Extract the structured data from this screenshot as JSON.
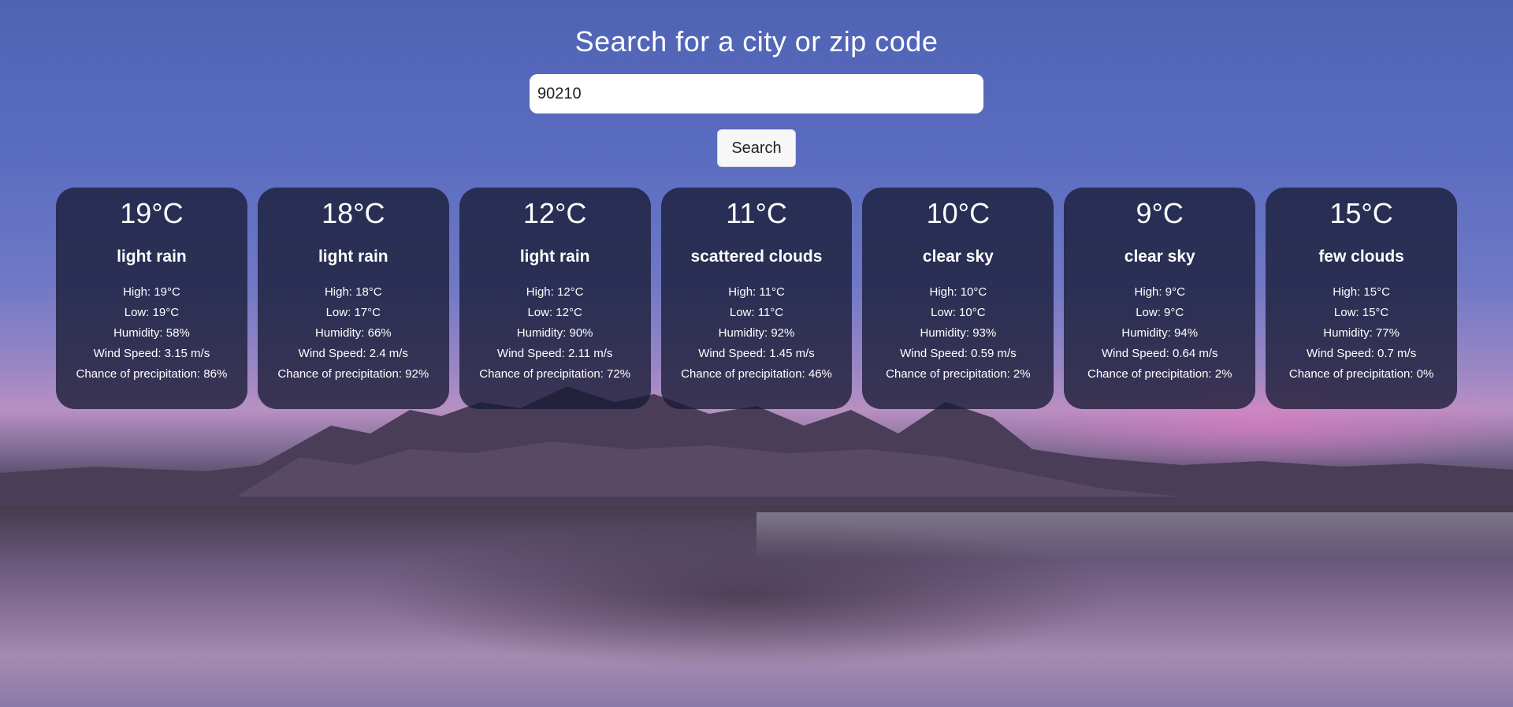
{
  "header": {
    "title": "Search for a city or zip code"
  },
  "search": {
    "value": "90210",
    "button_label": "Search"
  },
  "forecast": [
    {
      "temp": "19°C",
      "description": "light rain",
      "high": "High: 19°C",
      "low": "Low: 19°C",
      "humidity": "Humidity: 58%",
      "wind": "Wind Speed: 3.15 m/s",
      "precip": "Chance of precipitation: 86%"
    },
    {
      "temp": "18°C",
      "description": "light rain",
      "high": "High: 18°C",
      "low": "Low: 17°C",
      "humidity": "Humidity: 66%",
      "wind": "Wind Speed: 2.4 m/s",
      "precip": "Chance of precipitation: 92%"
    },
    {
      "temp": "12°C",
      "description": "light rain",
      "high": "High: 12°C",
      "low": "Low: 12°C",
      "humidity": "Humidity: 90%",
      "wind": "Wind Speed: 2.11 m/s",
      "precip": "Chance of precipitation: 72%"
    },
    {
      "temp": "11°C",
      "description": "scattered clouds",
      "high": "High: 11°C",
      "low": "Low: 11°C",
      "humidity": "Humidity: 92%",
      "wind": "Wind Speed: 1.45 m/s",
      "precip": "Chance of precipitation: 46%"
    },
    {
      "temp": "10°C",
      "description": "clear sky",
      "high": "High: 10°C",
      "low": "Low: 10°C",
      "humidity": "Humidity: 93%",
      "wind": "Wind Speed: 0.59 m/s",
      "precip": "Chance of precipitation: 2%"
    },
    {
      "temp": "9°C",
      "description": "clear sky",
      "high": "High: 9°C",
      "low": "Low: 9°C",
      "humidity": "Humidity: 94%",
      "wind": "Wind Speed: 0.64 m/s",
      "precip": "Chance of precipitation: 2%"
    },
    {
      "temp": "15°C",
      "description": "few clouds",
      "high": "High: 15°C",
      "low": "Low: 15°C",
      "humidity": "Humidity: 77%",
      "wind": "Wind Speed: 0.7 m/s",
      "precip": "Chance of precipitation: 0%"
    }
  ],
  "colors": {
    "card_background": "#181b34",
    "sky_top": "#4f63b4",
    "accent_pink": "#ec78c4"
  }
}
